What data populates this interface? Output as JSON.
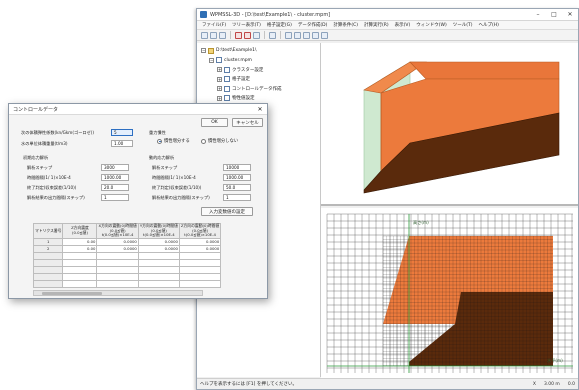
{
  "main_window": {
    "title": "WPMSSL-3D - [D:\\test\\Example1\\ - cluster.mpm]",
    "menu": [
      "ファイル(F)",
      "ツリー表示(T)",
      "格子設定(G)",
      "データ作成(D)",
      "計算条件(C)",
      "計算実行(R)",
      "表示(V)",
      "ウィンドウ(W)",
      "ツール(T)",
      "ヘルプ(H)"
    ],
    "tree": [
      {
        "label": "D:\\test\\Example1\\",
        "indent": 0,
        "icon": "folder-icon",
        "expander": "−"
      },
      {
        "label": "cluster.mpm",
        "indent": 1,
        "icon": "document-icon",
        "expander": "−"
      },
      {
        "label": "クラスター設定",
        "indent": 2,
        "icon": "document-icon",
        "expander": "+"
      },
      {
        "label": "格子設定",
        "indent": 2,
        "icon": "document-icon",
        "expander": "+"
      },
      {
        "label": "コントロールデータ作成",
        "indent": 2,
        "icon": "document-icon",
        "expander": "+"
      },
      {
        "label": "物性値設定",
        "indent": 2,
        "icon": "document-icon",
        "expander": "+"
      },
      {
        "label": "データ作成",
        "indent": 2,
        "icon": "document-icon",
        "expander": "+"
      }
    ],
    "mesh_labels": {
      "vertical": "高さ(m)",
      "horizontal": "水平(m)"
    },
    "status": {
      "hint": "ヘルプを表示するには [F1] を押してください。",
      "right": [
        "X",
        "3.00 m",
        "0.0"
      ]
    }
  },
  "dialog": {
    "title": "コントロールデータ",
    "ok_label": "OK",
    "cancel_label": "キャンセル",
    "left_fields": [
      {
        "label": "次の体積弾性係数(kn/Gkm(ゴーロゼ))",
        "value": "5",
        "active": true
      },
      {
        "label": "水の単位体積重量(t/m3)",
        "value": "1.00",
        "active": false
      }
    ],
    "initial_analysis": {
      "heading": "初期応力解析",
      "rows": [
        {
          "label": "解析ステップ",
          "value": "3000"
        },
        {
          "label": "時間間隔(1/ 1)×10E-4",
          "value": "1000.00"
        },
        {
          "label": "終了判定(収束誤差(1/10))",
          "value": "20.0"
        },
        {
          "label": "解析結果の出力間隔(ステップ)",
          "value": "1"
        }
      ]
    },
    "gravity_group": {
      "heading": "重力慣性",
      "options": [
        {
          "label": "慣性増分する",
          "selected": true
        },
        {
          "label": "慣性増分しない",
          "selected": false
        }
      ]
    },
    "main_analysis": {
      "heading": "動的応力解析",
      "rows": [
        {
          "label": "解析ステップ",
          "value": "10000"
        },
        {
          "label": "時間間隔(1/ 1)×10E-4",
          "value": "1000.00"
        },
        {
          "label": "終了判定(収束誤差(1/10))",
          "value": "50.0"
        },
        {
          "label": "解析結果の出力間隔(ステップ)",
          "value": "1"
        }
      ],
      "settings_button": "入力変数値の設定"
    },
    "table": {
      "headers": [
        "マトリクス番号",
        "Z方向震度\n(0.0≦値)",
        "X方向の震動(0)時間値\n(0.0≦値)\nt(0.0≦値)×10E-4",
        "Y方向の震動(0)時間値\n(0.0≦値)\nt(0.0≦値)×10E-4",
        "Z方向の震動(0)時間値\n(0.0≦値)\nt(0.0≦値)×10E-4"
      ],
      "rows": [
        [
          "1",
          "0.00",
          "0.0000",
          "0.0000",
          "0.0000"
        ],
        [
          "2",
          "0.00",
          "0.0000",
          "0.0000",
          "0.0000"
        ],
        [
          "",
          "",
          "",
          "",
          ""
        ],
        [
          "",
          "",
          "",
          "",
          ""
        ],
        [
          "",
          "",
          "",
          "",
          ""
        ],
        [
          "",
          "",
          "",
          "",
          ""
        ],
        [
          "",
          "",
          "",
          "",
          ""
        ]
      ]
    }
  },
  "colors": {
    "soil_orange": "#ec7a3c",
    "soil_brown": "#5a2a0c",
    "side_green": "#cfe9d0",
    "mesh_line": "#1a1a1a",
    "axis_green": "#2a9a3a",
    "accent_blue": "#2d6fc2"
  }
}
